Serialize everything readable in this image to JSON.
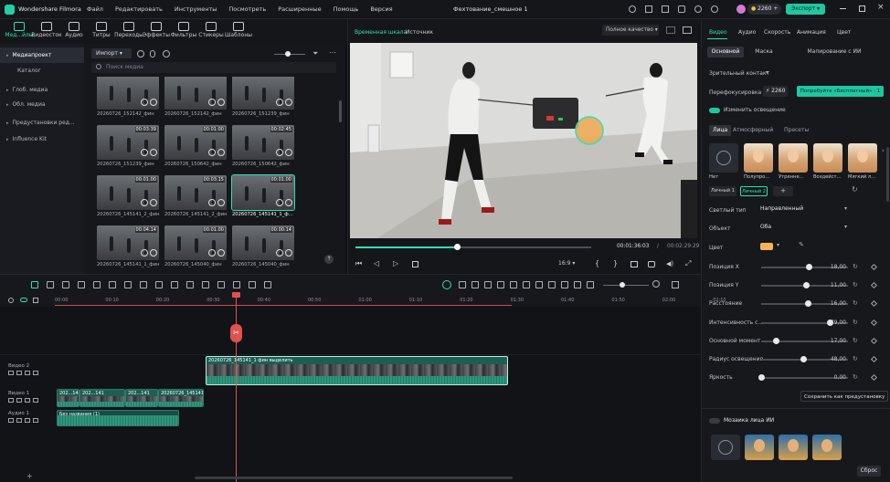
{
  "app": {
    "name": "Wondershare Filmora",
    "project_title": "Фехтование_смешное 1",
    "credits": "2260",
    "export_label": "Экспорт"
  },
  "menu": [
    "Файл",
    "Редактировать",
    "Инструменты",
    "Посмотреть",
    "Расширенные",
    "Помощь",
    "Версия"
  ],
  "toolbar": [
    {
      "label": "Мед...йлы",
      "icon": "media-icon",
      "active": true
    },
    {
      "label": "Видеосток",
      "icon": "stock-video-icon"
    },
    {
      "label": "Аудио",
      "icon": "music-icon"
    },
    {
      "label": "Титры",
      "icon": "text-icon"
    },
    {
      "label": "Переходы",
      "icon": "transition-icon"
    },
    {
      "label": "Эффекты",
      "icon": "effects-icon"
    },
    {
      "label": "Фильтры",
      "icon": "filter-icon"
    },
    {
      "label": "Стикеры",
      "icon": "sticker-icon"
    },
    {
      "label": "Шаблоны",
      "icon": "template-icon"
    }
  ],
  "leftnav": [
    {
      "label": "Медиапроект",
      "selected": true
    },
    {
      "label": "Каталог"
    },
    {
      "label": "Глоб. медиа"
    },
    {
      "label": "Обл. медиа"
    },
    {
      "label": "Предустановки ред..."
    },
    {
      "label": "Influence Kit"
    }
  ],
  "media": {
    "import_label": "Импорт",
    "search_placeholder": "Поиск медиа",
    "rows": [
      [
        {
          "name": "20260726_152142_фин",
          "dur": ""
        },
        {
          "name": "20260726_152142_фин",
          "dur": ""
        },
        {
          "name": "20260726_151239_фин",
          "dur": ""
        }
      ],
      [
        {
          "name": "20260726_151239_фин",
          "dur": "00:03:39"
        },
        {
          "name": "20260726_150642_фин",
          "dur": "00:01:00"
        },
        {
          "name": "20260726_150642_фин",
          "dur": "00:02:45"
        }
      ],
      [
        {
          "name": "20260726_145141_2_фин",
          "dur": "00:01:00"
        },
        {
          "name": "20260726_145141_2_фин",
          "dur": "00:03:15"
        },
        {
          "name": "20260726_145141_1_ф...",
          "dur": "00:01:00",
          "selected": true
        }
      ],
      [
        {
          "name": "20260726_145141_1_фин",
          "dur": "00:04:14"
        },
        {
          "name": "20260726_145040_фин",
          "dur": "00:01:00"
        },
        {
          "name": "20260726_145040_фин",
          "dur": "00:00:14"
        }
      ]
    ]
  },
  "preview": {
    "tabs": [
      "Временная шкала",
      "Источник"
    ],
    "quality": "Полное качество",
    "current_time": "00:01:36:03",
    "total_time": "00:02:29:29",
    "ratio": "16:9",
    "progress": 0.43
  },
  "right": {
    "tabs": [
      "Видео",
      "Аудио",
      "Скорость",
      "Анимация",
      "Цвет"
    ],
    "subtabs": [
      "Основной",
      "Маска",
      "Мапирование с ИИ"
    ],
    "focus_label": "Зрительный контакт",
    "reframe_label": "Перефокусировка",
    "reframe_credits": "2260",
    "try_label": "Попробуйте «Бесплатный» : 1",
    "lighting_label": "Изменить освещение",
    "light_tabs": [
      "Лица",
      "Атмосферный",
      "Пресеты"
    ],
    "presets": [
      "Нет",
      "Полупро...",
      "Утренне...",
      "Воздейст...",
      "Мягкий л..."
    ],
    "faces": [
      "Личный 1",
      "Личный 2"
    ],
    "light_type_label": "Светлый тип",
    "light_type_value": "Направленный",
    "object_label": "Объект",
    "object_value": "Оба",
    "color_label": "Цвет",
    "color_value": "#f4b35a",
    "params": [
      {
        "label": "Позиция X",
        "value": "18,00",
        "level": 0.55
      },
      {
        "label": "Позиция Y",
        "value": "11,00",
        "level": 0.52
      },
      {
        "label": "Расстояние",
        "value": "16,00",
        "level": 0.54
      },
      {
        "label": "Интенсивность с...",
        "value": "79,00",
        "level": 0.79
      },
      {
        "label": "Основной момент",
        "value": "17,00",
        "level": 0.17
      },
      {
        "label": "Радиус освещения",
        "value": "48,00",
        "level": 0.48
      },
      {
        "label": "Яркость",
        "value": "0,00",
        "level": 0.0
      }
    ],
    "save_preset": "Сохранить как предустановку",
    "mosaic_label": "Мозаика лица ИИ",
    "reset_label": "Сброс"
  },
  "timeline": {
    "ticks": [
      "00:00",
      "00:10",
      "00:20",
      "00:30",
      "00:40",
      "00:50",
      "01:00",
      "01:10",
      "01:20",
      "01:30",
      "01:40",
      "01:50",
      "02:00",
      "02:10"
    ],
    "tracks": [
      {
        "label": "Видео 2"
      },
      {
        "label": "Видео 1"
      },
      {
        "label": "Аудио 1"
      }
    ],
    "clips": {
      "v2": "20260726_145141_1 фин выделить",
      "v1": [
        "202...141",
        "202...141",
        "202...141",
        "20260726_145141"
      ],
      "a1": "Без названия (1)"
    }
  }
}
